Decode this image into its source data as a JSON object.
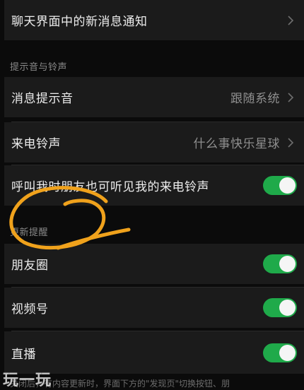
{
  "rows": {
    "chat_new_msg_notify": {
      "label": "聊天界面中的新消息通知"
    },
    "message_sound": {
      "label": "消息提示音",
      "value": "跟随系统"
    },
    "ringtone": {
      "label": "来电铃声",
      "value": "什么事快乐星球"
    },
    "friend_hear_ringtone": {
      "label": "呼叫我时朋友也可听见我的来电铃声",
      "toggle_on": true
    },
    "moments": {
      "label": "朋友圈",
      "toggle_on": true
    },
    "channels": {
      "label": "视频号",
      "toggle_on": true
    },
    "live": {
      "label": "直播",
      "toggle_on": true
    }
  },
  "sections": {
    "sound_ringtone": "提示音与铃声",
    "update_reminder": "更新提醒"
  },
  "footer": {
    "text": "关闭后，有内容更新时，界面下方的\"发现页\"切换按钮、朋"
  },
  "watermark": {
    "text": "玩一玩"
  },
  "colors": {
    "toggle_on": "#1faa4a",
    "annotation": "#f0a21c"
  },
  "icons": {
    "chevron": "chevron-right-icon"
  }
}
